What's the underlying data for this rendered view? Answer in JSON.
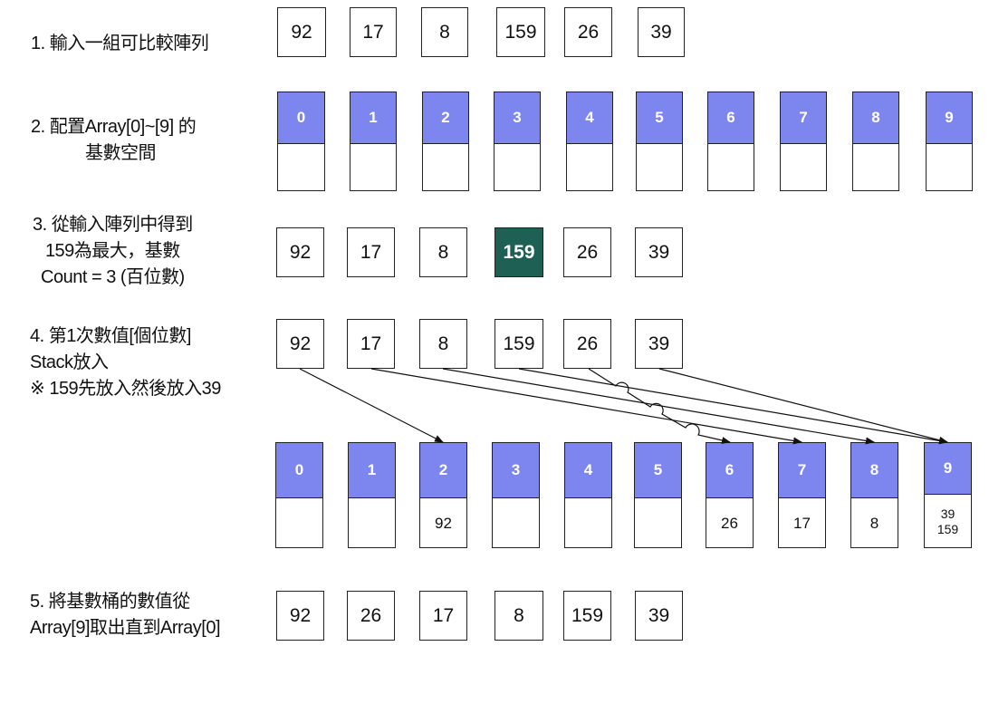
{
  "steps": [
    {
      "lines": [
        "1. 輸入一組可比較陣列"
      ]
    },
    {
      "lines": [
        "2. 配置Array[0]~[9] 的",
        "基數空間"
      ]
    },
    {
      "lines": [
        "3. 從輸入陣列中得到",
        "159為最大，基數",
        "Count = 3 (百位數)"
      ]
    },
    {
      "lines": [
        "4. 第1次數值[個位數]",
        "Stack放入",
        "※ 159先放入然後放入39"
      ]
    },
    {
      "lines": [
        "5. 將基數桶的數值從",
        "Array[9]取出直到Array[0]"
      ]
    }
  ],
  "input_array": [
    "92",
    "17",
    "8",
    "159",
    "26",
    "39"
  ],
  "bucket_labels": [
    "0",
    "1",
    "2",
    "3",
    "4",
    "5",
    "6",
    "7",
    "8",
    "9"
  ],
  "max_array": {
    "values": [
      "92",
      "17",
      "8",
      "159",
      "26",
      "39"
    ],
    "highlight_index": 3
  },
  "stack_array": [
    "92",
    "17",
    "8",
    "159",
    "26",
    "39"
  ],
  "filled_buckets": [
    [],
    [],
    [
      "92"
    ],
    [],
    [],
    [],
    [
      "26"
    ],
    [
      "17"
    ],
    [
      "8"
    ],
    [
      "39",
      "159"
    ]
  ],
  "result_array": [
    "92",
    "26",
    "17",
    "8",
    "159",
    "39"
  ],
  "colors": {
    "bucket_header": "#7d86ef",
    "highlight": "#1f6055"
  }
}
